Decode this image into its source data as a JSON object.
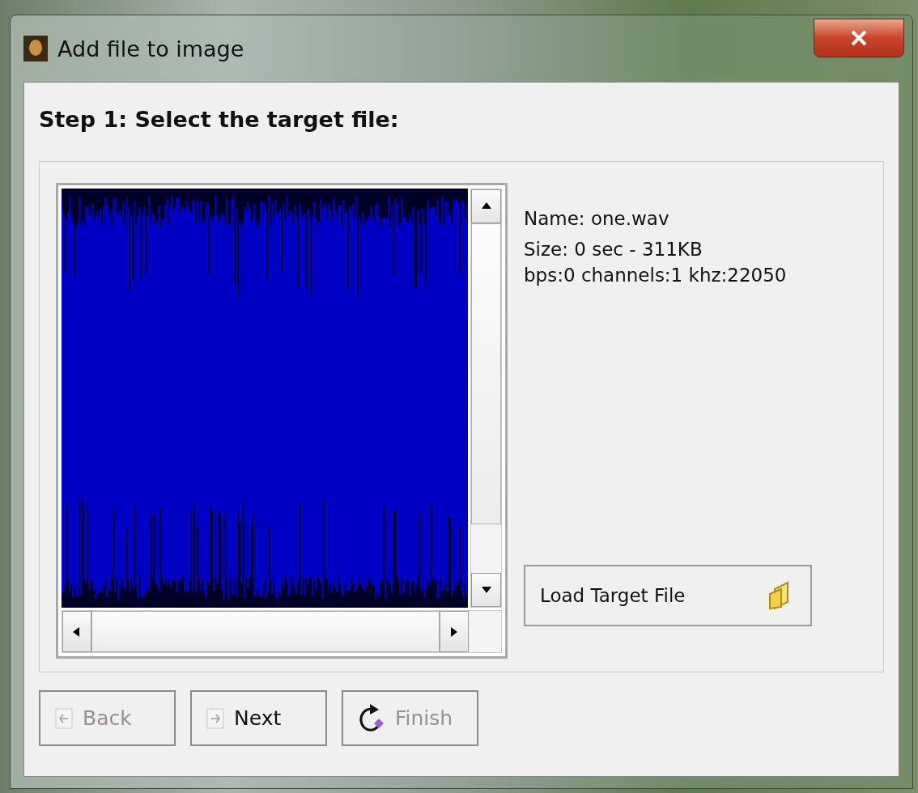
{
  "window": {
    "title": "Add file to image"
  },
  "heading": "Step 1: Select the target file:",
  "file_info": [
    "Name: one.wav",
    "Size: 0 sec - 311KB",
    "bps:0 channels:1 khz:22050"
  ],
  "load_button": {
    "label": "Load Target File"
  },
  "buttons": [
    {
      "kind": "back",
      "label": "Back",
      "disabled": true
    },
    {
      "kind": "next",
      "label": "Next",
      "disabled": false
    },
    {
      "kind": "finish",
      "label": "Finish",
      "disabled": true
    }
  ]
}
